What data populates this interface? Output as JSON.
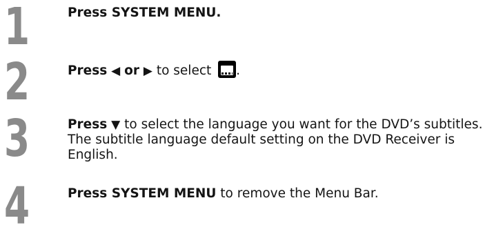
{
  "steps": [
    {
      "number": "1",
      "lead_bold": "Press SYSTEM MENU.",
      "rest": ""
    },
    {
      "number": "2",
      "lead_bold": "Press",
      "left_arrow": "◀",
      "or": "or",
      "right_arrow": "▶",
      "rest": "to select",
      "icon": "subtitle-icon",
      "trail": "."
    },
    {
      "number": "3",
      "lead_bold": "Press",
      "down_arrow": "▼",
      "rest": "to select the language you want for the DVD’s subtitles.",
      "line2": "The subtitle language default setting on the DVD Receiver is",
      "line3": "English."
    },
    {
      "number": "4",
      "lead_bold": "Press SYSTEM MENU",
      "rest": "to remove the Menu Bar."
    }
  ],
  "colors": {
    "step_number": "#8a8a8a",
    "text": "#141414"
  }
}
